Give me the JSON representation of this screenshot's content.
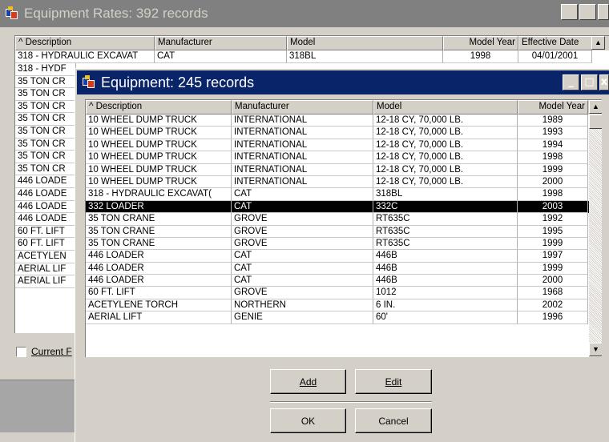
{
  "background_window": {
    "title": "Equipment Rates: 392 records",
    "columns": [
      "Description",
      "Manufacturer",
      "Model",
      "Model Year",
      "Effective Date"
    ],
    "first_row": [
      "318 - HYDRAULIC EXCAVAT",
      "CAT",
      "318BL",
      "1998",
      "04/01/2001"
    ],
    "peek_rows": [
      "318 - HYDF",
      "35 TON CR",
      "35 TON CR",
      "35 TON CR",
      "35 TON CR",
      "35 TON CR",
      "35 TON CR",
      "35 TON CR",
      "35 TON CR",
      "446 LOADE",
      "446 LOADE",
      "446 LOADE",
      "446 LOADE",
      "60 FT. LIFT",
      "60 FT. LIFT",
      "ACETYLEN",
      "AERIAL LIF",
      "AERIAL LIF"
    ],
    "checkbox_label": "Current F"
  },
  "dialog": {
    "title": "Equipment: 245 records",
    "columns": [
      "Description",
      "Manufacturer",
      "Model",
      "Model Year"
    ],
    "rows": [
      [
        "10 WHEEL DUMP TRUCK",
        "INTERNATIONAL",
        "12-18 CY, 70,000 LB.",
        "1989"
      ],
      [
        "10 WHEEL DUMP TRUCK",
        "INTERNATIONAL",
        "12-18 CY, 70,000 LB.",
        "1993"
      ],
      [
        "10 WHEEL DUMP TRUCK",
        "INTERNATIONAL",
        "12-18 CY, 70,000 LB.",
        "1994"
      ],
      [
        "10 WHEEL DUMP TRUCK",
        "INTERNATIONAL",
        "12-18 CY, 70,000 LB.",
        "1998"
      ],
      [
        "10 WHEEL DUMP TRUCK",
        "INTERNATIONAL",
        "12-18 CY, 70,000 LB.",
        "1999"
      ],
      [
        "10 WHEEL DUMP TRUCK",
        "INTERNATIONAL",
        "12-18 CY, 70,000 LB.",
        "2000"
      ],
      [
        "318 - HYDRAULIC EXCAVAT(",
        "CAT",
        "318BL",
        "1998"
      ],
      [
        "332 LOADER",
        "CAT",
        "332C",
        "2003"
      ],
      [
        "35 TON CRANE",
        "GROVE",
        "RT635C",
        "1992"
      ],
      [
        "35 TON CRANE",
        "GROVE",
        "RT635C",
        "1995"
      ],
      [
        "35 TON CRANE",
        "GROVE",
        "RT635C",
        "1999"
      ],
      [
        "446 LOADER",
        "CAT",
        "446B",
        "1997"
      ],
      [
        "446 LOADER",
        "CAT",
        "446B",
        "1999"
      ],
      [
        "446 LOADER",
        "CAT",
        "446B",
        "2000"
      ],
      [
        "60 FT. LIFT",
        "GROVE",
        "1012",
        "1968"
      ],
      [
        "ACETYLENE TORCH",
        "NORTHERN",
        "6 IN.",
        "2002"
      ],
      [
        "AERIAL LIFT",
        "GENIE",
        "60'",
        "1996"
      ]
    ],
    "selected_index": 7,
    "buttons": {
      "add": "Add",
      "edit": "Edit",
      "ok": "OK",
      "cancel": "Cancel"
    }
  },
  "colors": {
    "active_title": "#0a246a",
    "inactive_title": "#808080",
    "selection": "#000000"
  }
}
